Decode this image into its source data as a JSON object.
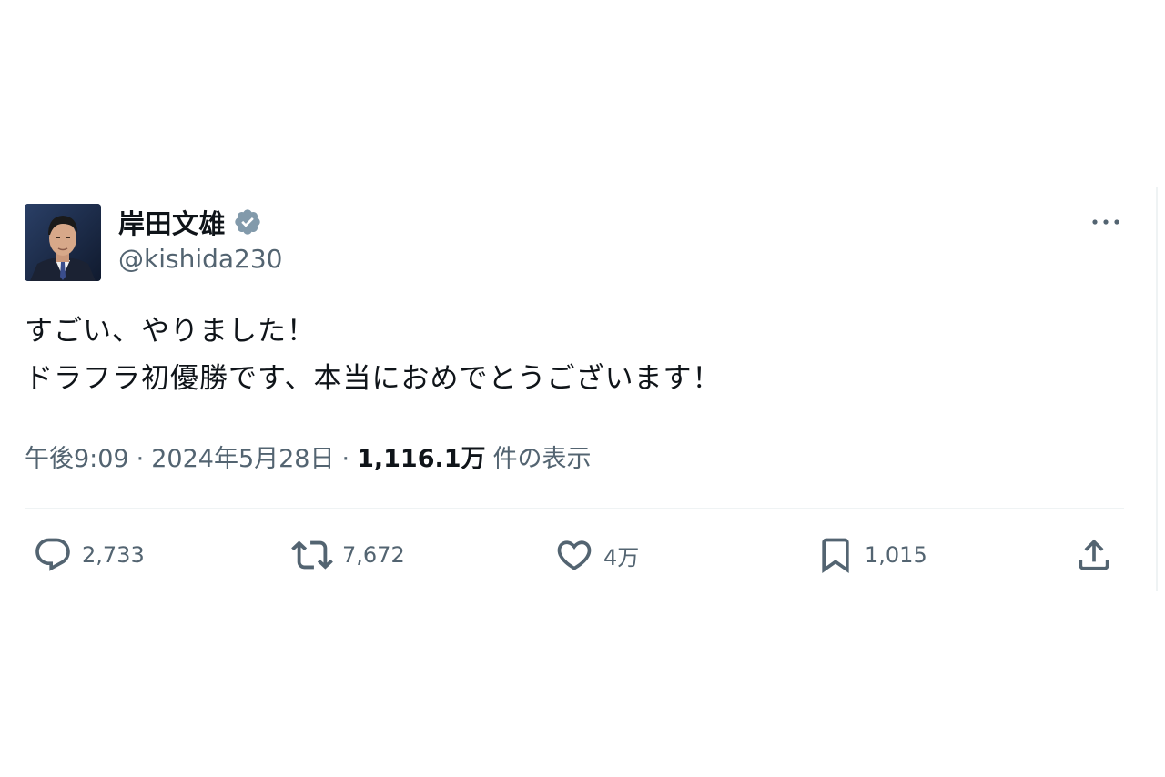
{
  "tweet": {
    "display_name": "岸田文雄",
    "handle": "@kishida230",
    "text_lines": [
      "すごい、やりました！",
      "ドラフラ初優勝です、本当におめでとうございます！"
    ],
    "time": "午後9:09",
    "date": "2024年5月28日",
    "meta_separator": "·",
    "views_count": "1,116.1万",
    "views_label": "件の表示"
  },
  "actions": {
    "replies": "2,733",
    "retweets": "7,672",
    "likes": "4万",
    "bookmarks": "1,015"
  },
  "icons": {
    "avatar": "profile-photo",
    "verified": "verified-badge-icon",
    "more": "more-icon",
    "reply": "reply-icon",
    "retweet": "retweet-icon",
    "like": "heart-icon",
    "bookmark": "bookmark-icon",
    "share": "share-icon"
  },
  "colors": {
    "text_primary": "#0f1419",
    "text_secondary": "#536471",
    "verified_badge": "#829aab",
    "divider": "#eff3f4"
  }
}
